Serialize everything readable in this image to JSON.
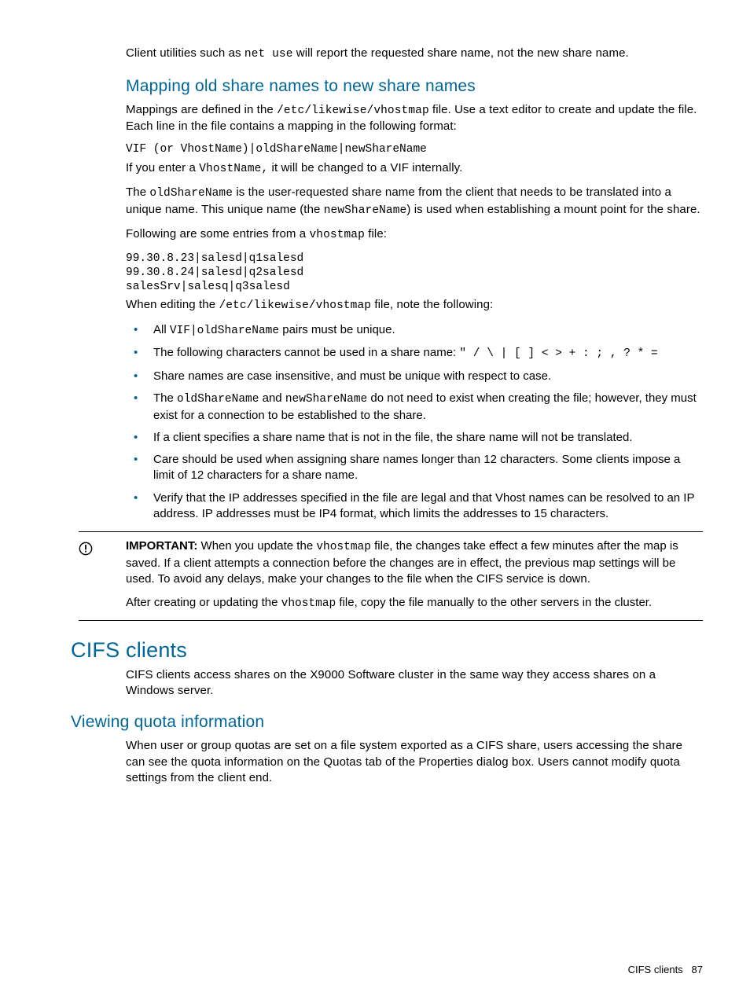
{
  "intro": {
    "p1a": "Client utilities such as ",
    "p1_code": "net use",
    "p1b": " will report the requested share name, not the new share name."
  },
  "mapping": {
    "heading": "Mapping old share names to new share names",
    "p1a": "Mappings are defined in the ",
    "p1_code": "/etc/likewise/vhostmap",
    "p1b": " file. Use a text editor to create and update the file. Each line in the file contains a mapping in the following format:",
    "syntax": "VIF (or VhostName)|oldShareName|newShareName",
    "p2a": "If you enter a ",
    "p2_code": "VhostName,",
    "p2b": " it will be changed to a VIF internally.",
    "p3a": "The ",
    "p3_code1": "oldShareName",
    "p3b": " is the user-requested share name from the client that needs to be translated into a unique name. This unique name (the ",
    "p3_code2": "newShareName",
    "p3c": ") is used when establishing a mount point for the share.",
    "p4a": "Following are some entries from a ",
    "p4_code": "vhostmap",
    "p4b": " file:",
    "example": "99.30.8.23|salesd|q1salesd\n99.30.8.24|salesd|q2salesd\nsalesSrv|salesq|q3salesd",
    "p5a": "When editing the ",
    "p5_code": "/etc/likewise/vhostmap",
    "p5b": " file, note the following:",
    "bullets": {
      "b1a": "All ",
      "b1_code": "VIF|oldShareName",
      "b1b": " pairs must be unique.",
      "b2a": "The following characters cannot be used in a share name: ",
      "b2_code": "\" / \\ | [ ] < > + : ; , ? * =",
      "b3": "Share names are case insensitive, and must be unique with respect to case.",
      "b4a": "The ",
      "b4_code1": "oldShareName",
      "b4b": " and ",
      "b4_code2": "newShareName",
      "b4c": " do not need to exist when creating the file; however, they must exist for a connection to be established to the share.",
      "b5": "If a client specifies a share name that is not in the file, the share name will not be translated.",
      "b6": "Care should be used when assigning share names longer than 12 characters. Some clients impose a limit of 12 characters for a share name.",
      "b7": "Verify that the IP addresses specified in the file are legal and that Vhost names can be resolved to an IP address. IP addresses must be IP4 format, which limits the addresses to 15 characters."
    }
  },
  "important": {
    "label": "IMPORTANT:",
    "p1a": "   When you update the ",
    "p1_code": "vhostmap",
    "p1b": " file, the changes take effect a few minutes after the map is saved. If a client attempts a connection before the changes are in effect, the previous map settings will be used. To avoid any delays, make your changes to the file when the CIFS service is down.",
    "p2a": "After creating or updating the ",
    "p2_code": "vhostmap",
    "p2b": " file, copy the file manually to the other servers in the cluster."
  },
  "cifs": {
    "heading": "CIFS clients",
    "p1": "CIFS clients access shares on the X9000 Software cluster in the same way they access shares on a Windows server."
  },
  "quota": {
    "heading": "Viewing quota information",
    "p1": "When user or group quotas are set on a file system exported as a CIFS share, users accessing the share can see the quota information on the Quotas tab of the Properties dialog box. Users cannot modify quota settings from the client end."
  },
  "footer": {
    "label": "CIFS clients",
    "page": "87"
  }
}
